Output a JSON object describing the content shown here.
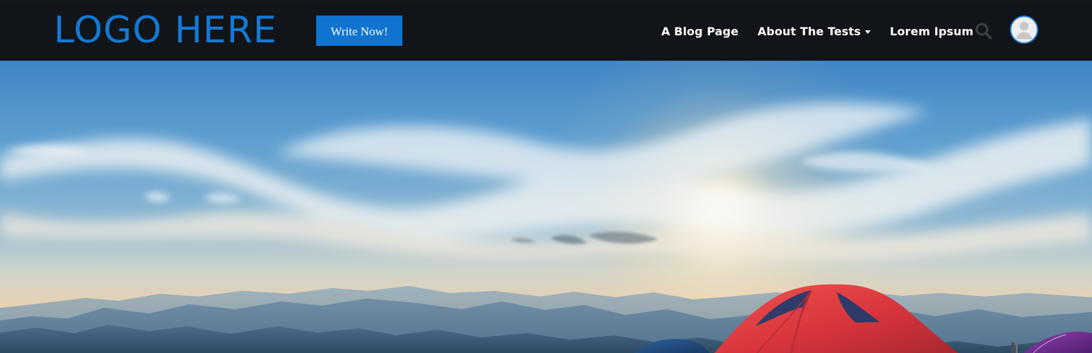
{
  "header": {
    "logo_text": "LOGO HERE",
    "cta_label": "Write Now!",
    "nav_items": [
      {
        "label": "A Blog Page"
      },
      {
        "label": "About The Tests",
        "has_dropdown": true
      },
      {
        "label": "Lorem Ipsum"
      }
    ],
    "search_icon": "search-icon",
    "avatar_icon": "user-avatar-icon"
  },
  "hero": {
    "image_subject": "sunrise-over-mountain-camp",
    "sky_color": "#4f91c8",
    "sunlight_color": "#f6ead5",
    "tent_color": "#d9363b"
  },
  "colors": {
    "header_bg": "#111418",
    "brand_blue": "#1479d4",
    "cta_blue": "#0f74cf",
    "nav_text": "#ffffff",
    "search_icon": "#3b3f45"
  }
}
